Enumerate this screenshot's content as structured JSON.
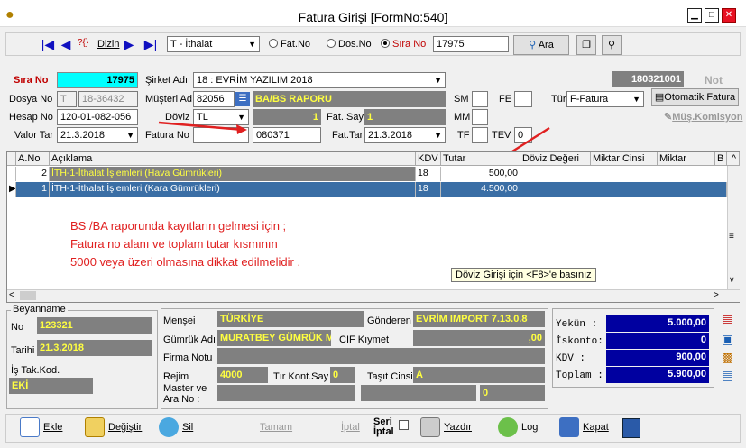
{
  "window": {
    "title": "Fatura Girişi [FormNo:540]",
    "minimize": "▁",
    "restore": "□",
    "close": "✕"
  },
  "toolbar": {
    "nav_first": "|◀",
    "nav_prev": "◀",
    "nav_find": "?{}",
    "nav_find_label": "Dizin",
    "nav_next": "▶",
    "nav_last": "▶|",
    "type_select": "T - İthalat",
    "radio_fat": "Fat.No",
    "radio_dos": "Dos.No",
    "radio_sira": "Sıra No",
    "search_value": "17975",
    "search_button": "Ara"
  },
  "header": {
    "sira_label": "Sıra No",
    "sira_value": "17975",
    "sirket_label": "Şirket Adı",
    "sirket_value": "18 : EVRİM YAZILIM 2018",
    "code_value": "180321001",
    "not_label": "Not",
    "dosya_label": "Dosya No",
    "dosya_prefix": "T",
    "dosya_value": "18-36432",
    "musteri_label": "Müşteri Adı",
    "musteri_code": "82056",
    "musteri_name": "BA/BS RAPORU",
    "sm_label": "SM",
    "fe_label": "FE",
    "tur_label": "Tür",
    "tur_value": "F-Fatura",
    "otomatik_button": "Otomatik Fatura",
    "hesap_label": "Hesap No",
    "hesap_value": "120-01-082-056",
    "doviz_label": "Döviz",
    "doviz_value": "TL",
    "doviz_rate": "1",
    "fatsay_label": "Fat. Say",
    "fatsay_value": "1",
    "mm_label": "MM",
    "muskom_button": "Müş.Komisyon",
    "valor_label": "Valor Tar",
    "valor_value": "21.3.2018",
    "faturano_label": "Fatura No",
    "faturano_value": "080371",
    "fattar_label": "Fat.Tar",
    "fattar_value": "21.3.2018",
    "tf_label": "TF",
    "tev_label": "TEV",
    "tev_value": "0"
  },
  "grid": {
    "columns": [
      "A.No",
      "Açıklama",
      "KDV",
      "Tutar",
      "Döviz Değeri",
      "Miktar Cinsi",
      "Miktar",
      "B"
    ],
    "rows": [
      {
        "no": "2",
        "desc": "İTH-1-İthalat İşlemleri  (Hava Gümrükleri)",
        "kdv": "18",
        "tutar": "500,00"
      },
      {
        "no": "1",
        "desc": "İTH-1-İthalat İşlemleri  (Kara Gümrükleri)",
        "kdv": "18",
        "tutar": "4.500,00"
      }
    ],
    "note_lines": [
      "BS /BA raporunda kayıtların gelmesi için ;",
      "Fatura no alanı ve toplam tutar kısmının",
      "5000 veya üzeri olmasına dikkat edilmelidir ."
    ],
    "hint": "Döviz Girişi için <F8>'e basınız"
  },
  "beyanname": {
    "group": "Beyanname",
    "no_label": "No",
    "no_value": "123321",
    "tarih_label": "Tarihi",
    "tarih_value": "21.3.2018",
    "istak_label": "İş Tak.Kod.",
    "istak_value": "EKİ"
  },
  "middle": {
    "mensei_label": "Menşei",
    "mensei_value": "TÜRKİYE",
    "gonderen_label": "Gönderen",
    "gonderen_value": "EVRİM IMPORT 7.13.0.8",
    "gumruk_label": "Gümrük Adı",
    "gumruk_value": "MURATBEY GÜMRÜK MÜ",
    "cif_label": "CIF Kıymet",
    "cif_value": ",00",
    "firma_label": "Firma Notu",
    "rejim_label": "Rejim",
    "rejim_value": "4000",
    "tir_label": "Tır Kont.Say",
    "tir_value": "0",
    "tasit_label": "Taşıt Cinsi",
    "tasit_value": "A",
    "master_label": "Master ve",
    "arano_label": "Ara No :",
    "master_extra": "0"
  },
  "totals": {
    "yekun_label": "Yekün   :",
    "yekun_value": "5.000,00",
    "iskonto_label": "İskonto:",
    "iskonto_value": "0",
    "kdv_label": "KDV     :",
    "kdv_value": "900,00",
    "toplam_label": "Toplam  :",
    "toplam_value": "5.900,00"
  },
  "bottom": {
    "ekle": "Ekle",
    "degistir": "Değiştir",
    "sil": "Sil",
    "tamam": "Tamam",
    "iptal": "İptal",
    "seri_iptal_1": "Seri",
    "seri_iptal_2": "İptal",
    "yazdir": "Yazdır",
    "log": "Log",
    "kapat": "Kapat"
  }
}
